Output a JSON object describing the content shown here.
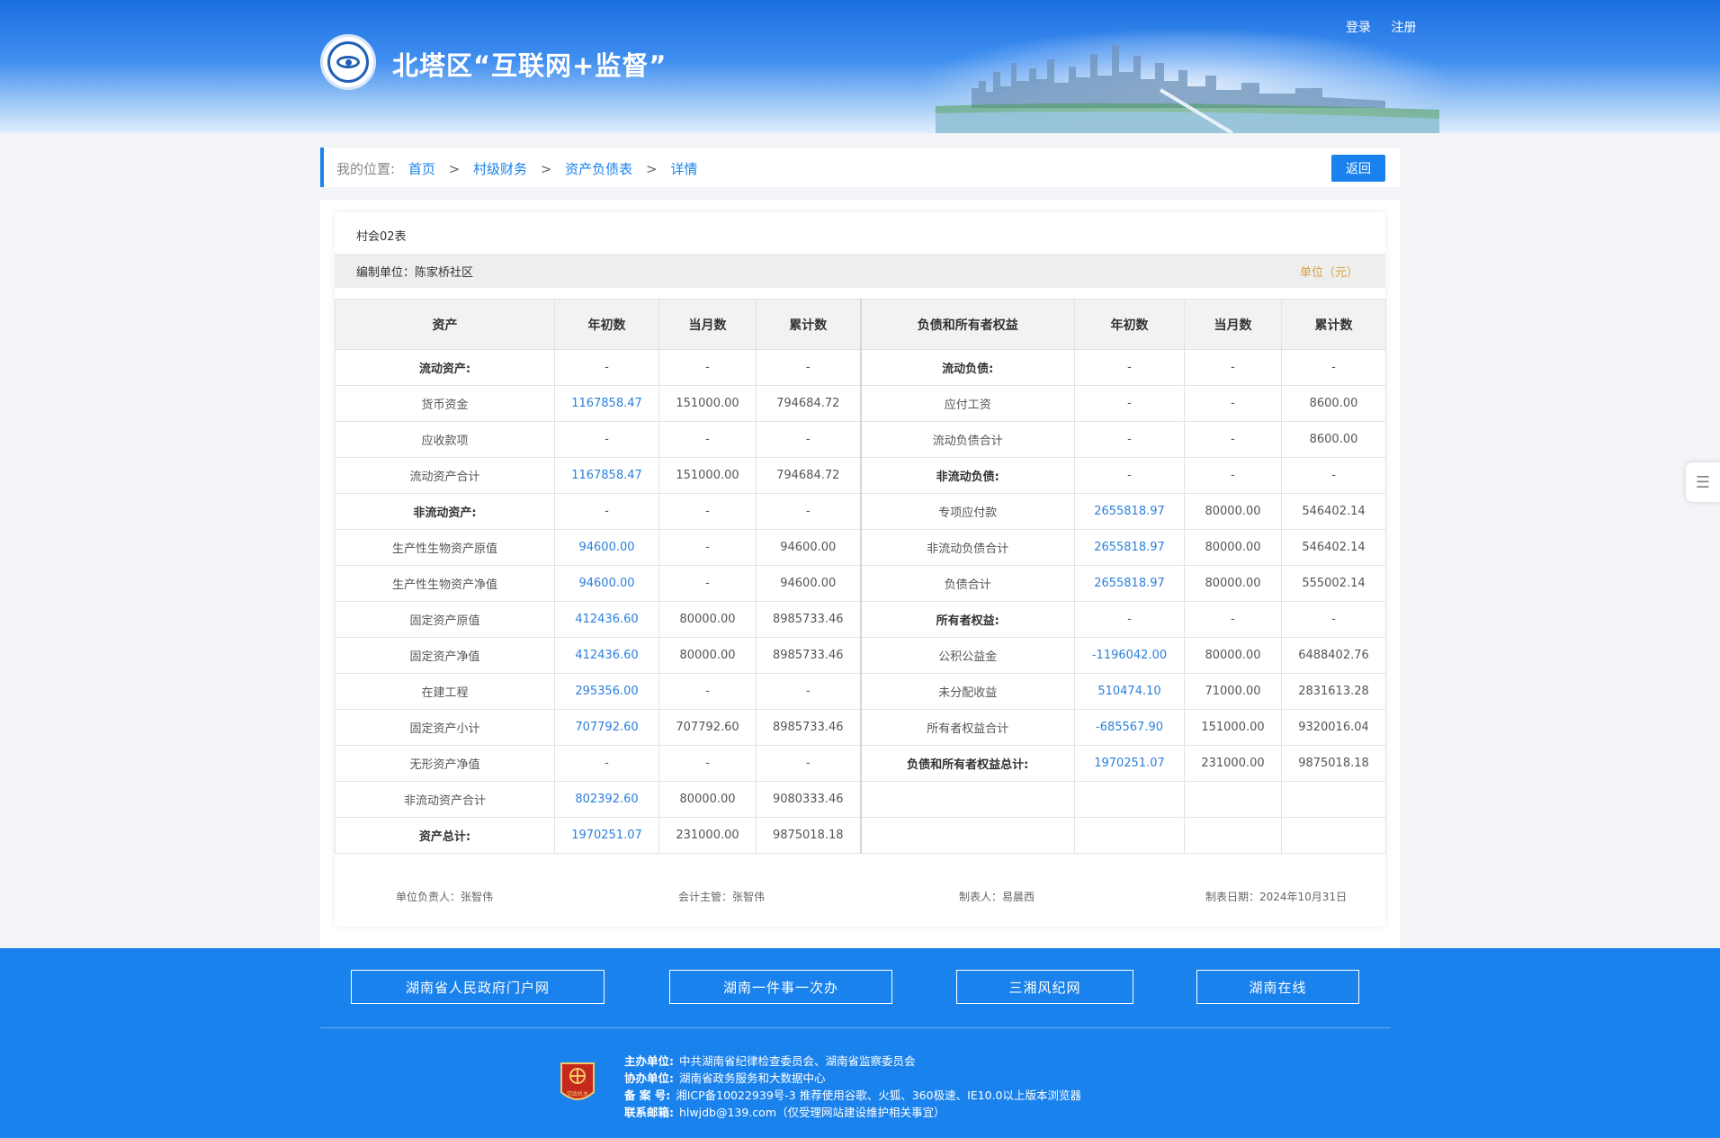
{
  "header": {
    "site_title": "北塔区“互联网+监督”",
    "login": "登录",
    "register": "注册"
  },
  "breadcrumb": {
    "prefix": "我的位置:",
    "items": [
      "首页",
      "村级财务",
      "资产负债表",
      "详情"
    ],
    "separator": ">",
    "back_label": "返回"
  },
  "report": {
    "table_no": "村会02表",
    "org": "编制单位：陈家桥社区",
    "unit": "单位（元）",
    "headers": [
      "资产",
      "年初数",
      "当月数",
      "累计数",
      "负债和所有者权益",
      "年初数",
      "当月数",
      "累计数"
    ],
    "rows": [
      {
        "a": [
          "流动资产:",
          "-",
          "-",
          "-"
        ],
        "a_bold": true,
        "l": [
          "流动负债:",
          "-",
          "-",
          "-"
        ],
        "l_bold": true
      },
      {
        "a": [
          "货币资金",
          "1167858.47",
          "151000.00",
          "794684.72"
        ],
        "l": [
          "应付工资",
          "-",
          "-",
          "8600.00"
        ]
      },
      {
        "a": [
          "应收款项",
          "-",
          "-",
          "-"
        ],
        "l": [
          "流动负债合计",
          "-",
          "-",
          "8600.00"
        ]
      },
      {
        "a": [
          "流动资产合计",
          "1167858.47",
          "151000.00",
          "794684.72"
        ],
        "l": [
          "非流动负债:",
          "-",
          "-",
          "-"
        ],
        "l_bold": true
      },
      {
        "a": [
          "非流动资产:",
          "-",
          "-",
          "-"
        ],
        "a_bold": true,
        "l": [
          "专项应付款",
          "2655818.97",
          "80000.00",
          "546402.14"
        ]
      },
      {
        "a": [
          "生产性生物资产原值",
          "94600.00",
          "-",
          "94600.00"
        ],
        "l": [
          "非流动负债合计",
          "2655818.97",
          "80000.00",
          "546402.14"
        ]
      },
      {
        "a": [
          "生产性生物资产净值",
          "94600.00",
          "-",
          "94600.00"
        ],
        "l": [
          "负债合计",
          "2655818.97",
          "80000.00",
          "555002.14"
        ]
      },
      {
        "a": [
          "固定资产原值",
          "412436.60",
          "80000.00",
          "8985733.46"
        ],
        "l": [
          "所有者权益:",
          "-",
          "-",
          "-"
        ],
        "l_bold": true
      },
      {
        "a": [
          "固定资产净值",
          "412436.60",
          "80000.00",
          "8985733.46"
        ],
        "l": [
          "公积公益金",
          "-1196042.00",
          "80000.00",
          "6488402.76"
        ]
      },
      {
        "a": [
          "在建工程",
          "295356.00",
          "-",
          "-"
        ],
        "l": [
          "未分配收益",
          "510474.10",
          "71000.00",
          "2831613.28"
        ]
      },
      {
        "a": [
          "固定资产小计",
          "707792.60",
          "707792.60",
          "8985733.46"
        ],
        "l": [
          "所有者权益合计",
          "-685567.90",
          "151000.00",
          "9320016.04"
        ]
      },
      {
        "a": [
          "无形资产净值",
          "-",
          "-",
          "-"
        ],
        "l": [
          "负债和所有者权益总计:",
          "1970251.07",
          "231000.00",
          "9875018.18"
        ],
        "l_bold": true
      },
      {
        "a": [
          "非流动资产合计",
          "802392.60",
          "80000.00",
          "9080333.46"
        ],
        "l": [
          "",
          "",
          "",
          ""
        ]
      },
      {
        "a": [
          "资产总计:",
          "1970251.07",
          "231000.00",
          "9875018.18"
        ],
        "a_bold": true,
        "l": [
          "",
          "",
          "",
          ""
        ]
      }
    ],
    "sign": {
      "leader": "单位负责人：张智伟",
      "accountant": "会计主管：张智伟",
      "preparer": "制表人：易晨西",
      "date": "制表日期：2024年10月31日"
    }
  },
  "footer": {
    "links": [
      "湖南省人民政府门户网",
      "湖南一件事一次办",
      "三湘风纪网",
      "湖南在线"
    ],
    "info": [
      {
        "k": "主办单位:",
        "v": "中共湖南省纪律检查委员会、湖南省监察委员会"
      },
      {
        "k": "协办单位:",
        "v": "湖南省政务服务和大数据中心"
      },
      {
        "k": "备  案  号:",
        "v": "湘ICP备10022939号-3   推荐使用谷歌、火狐、360极速、IE10.0以上版本浏览器"
      },
      {
        "k": "联系邮箱:",
        "v": "hlwjdb@139.com（仅受理网站建设维护相关事宜）"
      }
    ],
    "badge_text": "党政机关"
  },
  "colors": {
    "brand": "#1a82ec",
    "unit": "#d8a13a",
    "value_blue": "#2c7fdc"
  }
}
